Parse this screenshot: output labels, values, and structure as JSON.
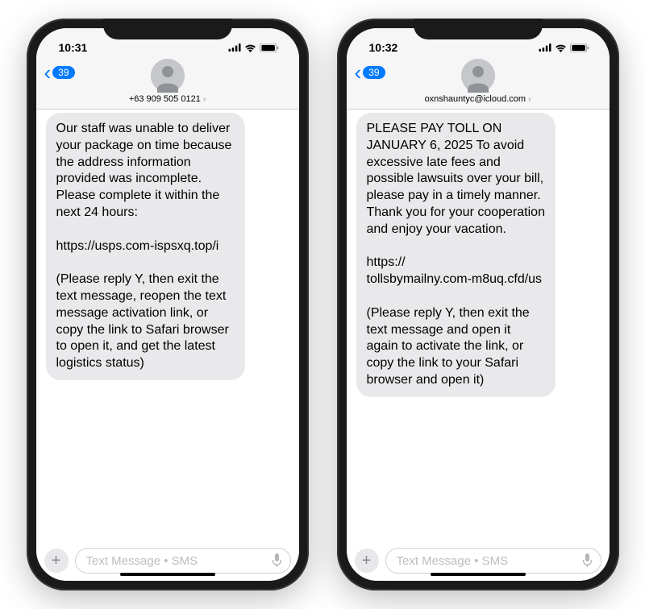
{
  "phones": [
    {
      "status": {
        "time": "10:31"
      },
      "nav": {
        "badge": "39"
      },
      "contact": {
        "name": "+63 909 505 0121"
      },
      "message": "Our staff was unable to deliver your package on time because the address information provided was incomplete. Please complete it within the next 24 hours:\n\nhttps://usps.com-ispsxq.top/i\n\n(Please reply Y, then exit the text message, reopen the text message activation link, or copy the link to Safari browser to open it, and get the latest logistics status)",
      "compose": {
        "placeholder": "Text Message • SMS"
      }
    },
    {
      "status": {
        "time": "10:32"
      },
      "nav": {
        "badge": "39"
      },
      "contact": {
        "name": "oxnshauntyc@icloud.com"
      },
      "message": "PLEASE PAY TOLL ON JANUARY 6, 2025 To avoid excessive late fees and possible lawsuits over your bill, please pay in a timely manner. Thank you for your cooperation and enjoy your vacation.\n\nhttps://\ntollsbymailny.com-m8uq.cfd/us\n\n(Please reply Y, then exit the text message and open it again to activate the link, or copy the link to your Safari browser and open it)",
      "compose": {
        "placeholder": "Text Message • SMS"
      }
    }
  ]
}
